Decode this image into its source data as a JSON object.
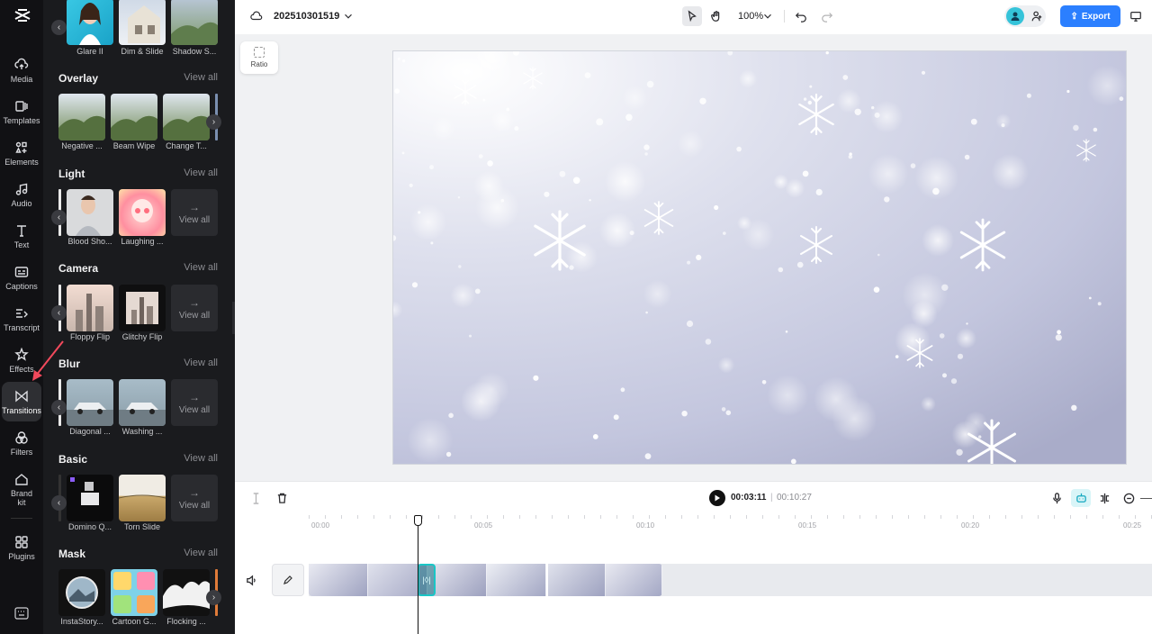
{
  "rail": {
    "items": [
      {
        "label": "Media"
      },
      {
        "label": "Templates"
      },
      {
        "label": "Elements"
      },
      {
        "label": "Audio"
      },
      {
        "label": "Text"
      },
      {
        "label": "Captions"
      },
      {
        "label": "Transcript"
      },
      {
        "label": "Effects"
      },
      {
        "label": "Transitions"
      },
      {
        "label": "Filters"
      },
      {
        "label": "Brand kit"
      },
      {
        "label": "Plugins"
      }
    ],
    "active": "Transitions"
  },
  "panel": {
    "top_row": [
      {
        "label": "Glare II"
      },
      {
        "label": "Dim & Slide"
      },
      {
        "label": "Shadow S..."
      }
    ],
    "sections": [
      {
        "title": "Overlay",
        "view_all": "View all",
        "items": [
          "Negative ...",
          "Beam Wipe",
          "Change T..."
        ]
      },
      {
        "title": "Light",
        "view_all": "View all",
        "items": [
          "Blood Sho...",
          "Laughing ..."
        ],
        "tile": "View all"
      },
      {
        "title": "Camera",
        "view_all": "View all",
        "items": [
          "Floppy Flip",
          "Glitchy Flip"
        ],
        "tile": "View all"
      },
      {
        "title": "Blur",
        "view_all": "View all",
        "items": [
          "Diagonal ...",
          "Washing ..."
        ],
        "tile": "View all"
      },
      {
        "title": "Basic",
        "view_all": "View all",
        "items": [
          "Domino Q...",
          "Torn Slide"
        ],
        "tile": "View all"
      },
      {
        "title": "Mask",
        "view_all": "View all",
        "items": [
          "InstaStory...",
          "Cartoon G...",
          "Flocking ..."
        ]
      }
    ]
  },
  "topbar": {
    "project_name": "202510301519",
    "zoom": "100%",
    "export_label": "Export"
  },
  "stage": {
    "ratio_label": "Ratio"
  },
  "timeline": {
    "current_time": "00:03:11",
    "separator": "|",
    "total_time": "00:10:27",
    "ruler": [
      "00:00",
      "00:05",
      "00:10",
      "00:15",
      "00:20",
      "00:25"
    ],
    "transition_glyph": "|◊|"
  },
  "colors": {
    "accent": "#2b7fff",
    "transition_marker": "#19c6c6",
    "rail_bg": "#111114",
    "panel_bg": "#1a1b1e"
  }
}
